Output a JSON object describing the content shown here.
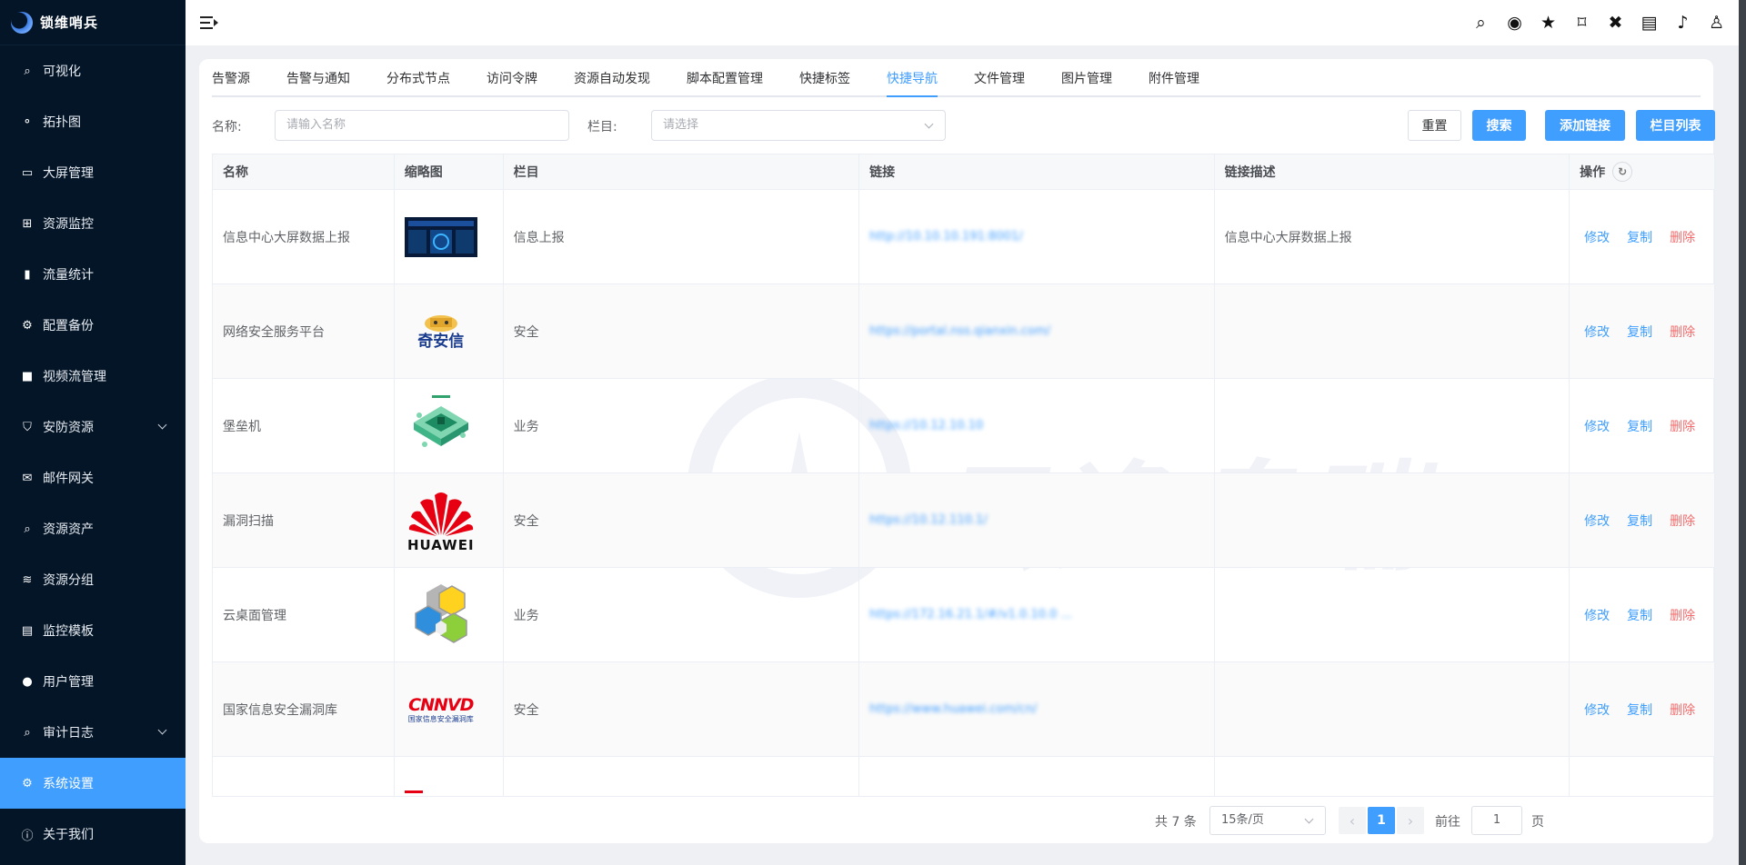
{
  "app": {
    "name": "锁维哨兵"
  },
  "sidebar": {
    "items": [
      {
        "label": "可视化",
        "icon": "search-chart-icon"
      },
      {
        "label": "拓扑图",
        "icon": "topology-icon"
      },
      {
        "label": "大屏管理",
        "icon": "monitor-icon"
      },
      {
        "label": "资源监控",
        "icon": "grid-icon"
      },
      {
        "label": "流量统计",
        "icon": "bar-chart-icon"
      },
      {
        "label": "配置备份",
        "icon": "settings-backup-icon"
      },
      {
        "label": "视频流管理",
        "icon": "video-icon"
      },
      {
        "label": "安防资源",
        "icon": "shield-icon",
        "expandable": true
      },
      {
        "label": "邮件网关",
        "icon": "mail-icon"
      },
      {
        "label": "资源资产",
        "icon": "search-icon"
      },
      {
        "label": "资源分组",
        "icon": "layers-icon"
      },
      {
        "label": "监控模板",
        "icon": "table-icon"
      },
      {
        "label": "用户管理",
        "icon": "user-icon"
      },
      {
        "label": "审计日志",
        "icon": "audit-search-icon",
        "expandable": true
      },
      {
        "label": "系统设置",
        "icon": "gear-icon",
        "active": true
      },
      {
        "label": "关于我们",
        "icon": "info-icon"
      }
    ]
  },
  "topbar": {
    "icons": [
      "search-icon",
      "ai-chat-icon",
      "star-icon",
      "bookmark-icon",
      "tools-icon",
      "server-icon",
      "bell-icon",
      "user-icon"
    ]
  },
  "tabs": [
    {
      "label": "告警源"
    },
    {
      "label": "告警与通知"
    },
    {
      "label": "分布式节点"
    },
    {
      "label": "访问令牌"
    },
    {
      "label": "资源自动发现"
    },
    {
      "label": "脚本配置管理"
    },
    {
      "label": "快捷标签"
    },
    {
      "label": "快捷导航",
      "active": true
    },
    {
      "label": "文件管理"
    },
    {
      "label": "图片管理"
    },
    {
      "label": "附件管理"
    }
  ],
  "filter": {
    "name_label": "名称:",
    "name_placeholder": "请输入名称",
    "column_label": "栏目:",
    "column_placeholder": "请选择",
    "reset": "重置",
    "search": "搜索",
    "add_link": "添加链接",
    "column_list": "栏目列表"
  },
  "table": {
    "headers": [
      "名称",
      "缩略图",
      "栏目",
      "链接",
      "链接描述",
      "操作"
    ],
    "actions": {
      "edit": "修改",
      "copy": "复制",
      "delete": "删除"
    },
    "rows": [
      {
        "name": "信息中心大屏数据上报",
        "thumb": "dashboard-screen-thumbnail",
        "column": "信息上报",
        "link": "http://10.10.10.191:8001/",
        "desc": "信息中心大屏数据上报"
      },
      {
        "name": "网络安全服务平台",
        "thumb": "qianxin-logo",
        "thumb_text": "奇安信",
        "column": "安全",
        "link": "https://portal.nss.qianxin.com/",
        "desc": ""
      },
      {
        "name": "堡垒机",
        "thumb": "bastion-host-illustration",
        "column": "业务",
        "link": "https://10.12.10.10",
        "desc": ""
      },
      {
        "name": "漏洞扫描",
        "thumb": "huawei-logo",
        "thumb_text": "HUAWEI",
        "column": "安全",
        "link": "https://10.12.110.1/",
        "desc": ""
      },
      {
        "name": "云桌面管理",
        "thumb": "cloud-desktop-logo",
        "column": "业务",
        "link": "https://172.16.21.1/#/v1.0.10.0 ...",
        "desc": ""
      },
      {
        "name": "国家信息安全漏洞库",
        "thumb": "cnnvd-logo",
        "thumb_text": "CNNVD",
        "thumb_subtext": "国家信息安全漏洞库",
        "column": "安全",
        "link": "https://www.huawei.com/cn/",
        "desc": ""
      },
      {
        "name": "",
        "thumb": "partial-logo",
        "column": "",
        "link": "",
        "desc": ""
      }
    ]
  },
  "pagination": {
    "total": "共 7 条",
    "page_size": "15条/页",
    "current_page": "1",
    "goto_label": "前往",
    "goto_value": "1",
    "page_suffix": "页"
  },
  "watermark": {
    "text": "云逸息瑞"
  },
  "colors": {
    "primary": "#409eff",
    "sidebar": "#041527",
    "danger": "#f56c6c"
  }
}
